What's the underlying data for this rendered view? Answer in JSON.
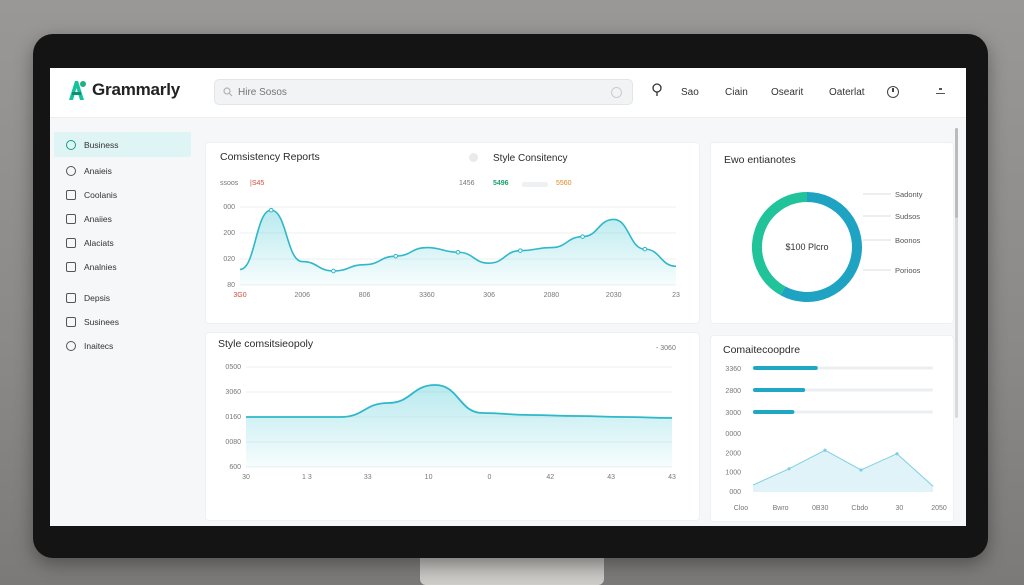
{
  "app": {
    "name": "Grammarly",
    "brand_color": "#15c39a",
    "accent": "#2bb7c9"
  },
  "topbar": {
    "search_placeholder": "Hire Sosos",
    "nav": [
      "Sao",
      "Ciain",
      "Osearit",
      "Oaterlat"
    ],
    "icons": [
      "pin-icon",
      "clock-icon",
      "menu-icon"
    ]
  },
  "sidebar": {
    "items": [
      {
        "label": "Business",
        "icon": "business-icon",
        "active": true
      },
      {
        "label": "Anaieis",
        "icon": "clock-icon"
      },
      {
        "label": "Coolanis",
        "icon": "calendar-icon"
      },
      {
        "label": "Anaiies",
        "icon": "chart-icon"
      },
      {
        "label": "Alaciats",
        "icon": "trend-icon"
      },
      {
        "label": "Analnies",
        "icon": "list-icon"
      },
      {
        "label": "Depsis",
        "icon": "report-icon"
      },
      {
        "label": "Susinees",
        "icon": "image-icon"
      },
      {
        "label": "Inaitecs",
        "icon": "help-icon"
      }
    ]
  },
  "consistency_card": {
    "title": "Comsistency Reports",
    "subtitle": "Style Consitency",
    "legend_left": [
      "ssoos",
      "|S45"
    ],
    "legend_right": [
      "1456",
      "5496",
      "5560"
    ]
  },
  "style_card": {
    "title": "Style comsitsieopoly",
    "top_right": "- 3060"
  },
  "donut_card": {
    "title": "Ewo entianotes",
    "center": "$100 Plcro",
    "labels": [
      "Sadonty",
      "Sudsos",
      "Boonos",
      "Porioos"
    ],
    "colors": [
      "#1fa3c2",
      "#20c39a"
    ]
  },
  "compare_card": {
    "title": "Comaitecoopdre",
    "bars": [
      {
        "label": "3360",
        "value": 0.36
      },
      {
        "label": "2800",
        "value": 0.29
      },
      {
        "label": "3000",
        "value": 0.23
      }
    ]
  },
  "chart_data": [
    {
      "type": "area",
      "title": "Comsistency Reports",
      "x": [
        "3G0",
        "2006",
        "806",
        "3360",
        "306",
        "2080",
        "2030",
        "23"
      ],
      "y_ticks": [
        "000",
        "200",
        "020",
        "80"
      ],
      "series": [
        {
          "values": [
            20,
            96,
            30,
            18,
            26,
            37,
            48,
            42,
            28,
            44,
            48,
            62,
            84,
            46,
            24
          ]
        }
      ],
      "ylim": [
        0,
        100
      ]
    },
    {
      "type": "area",
      "title": "Style comsitsieopoly",
      "x": [
        "30",
        "1 3",
        "33",
        "10",
        "0",
        "42",
        "43",
        "43"
      ],
      "y_ticks": [
        "0500",
        "3060",
        "0160",
        "0080",
        "600"
      ],
      "series": [
        {
          "values": [
            50,
            50,
            50,
            64,
            82,
            54,
            52,
            51,
            50,
            49
          ]
        }
      ],
      "ylim": [
        0,
        100
      ]
    },
    {
      "type": "pie",
      "title": "Ewo entianotes",
      "values": [
        58,
        42
      ],
      "labels": [
        "Sadonty",
        "Sudsos",
        "Boonos",
        "Porioos"
      ]
    },
    {
      "type": "area",
      "title": "Comaitecoopdre",
      "x": [
        "Cloo",
        "Bwro",
        "0B30",
        "Cbdo",
        "30",
        "2050"
      ],
      "y_ticks": [
        "3360",
        "2800",
        "3000",
        "0000",
        "2000",
        "1000",
        "000"
      ],
      "series": [
        {
          "values": [
            12,
            40,
            72,
            38,
            66,
            10
          ]
        }
      ],
      "ylim": [
        0,
        100
      ]
    }
  ]
}
